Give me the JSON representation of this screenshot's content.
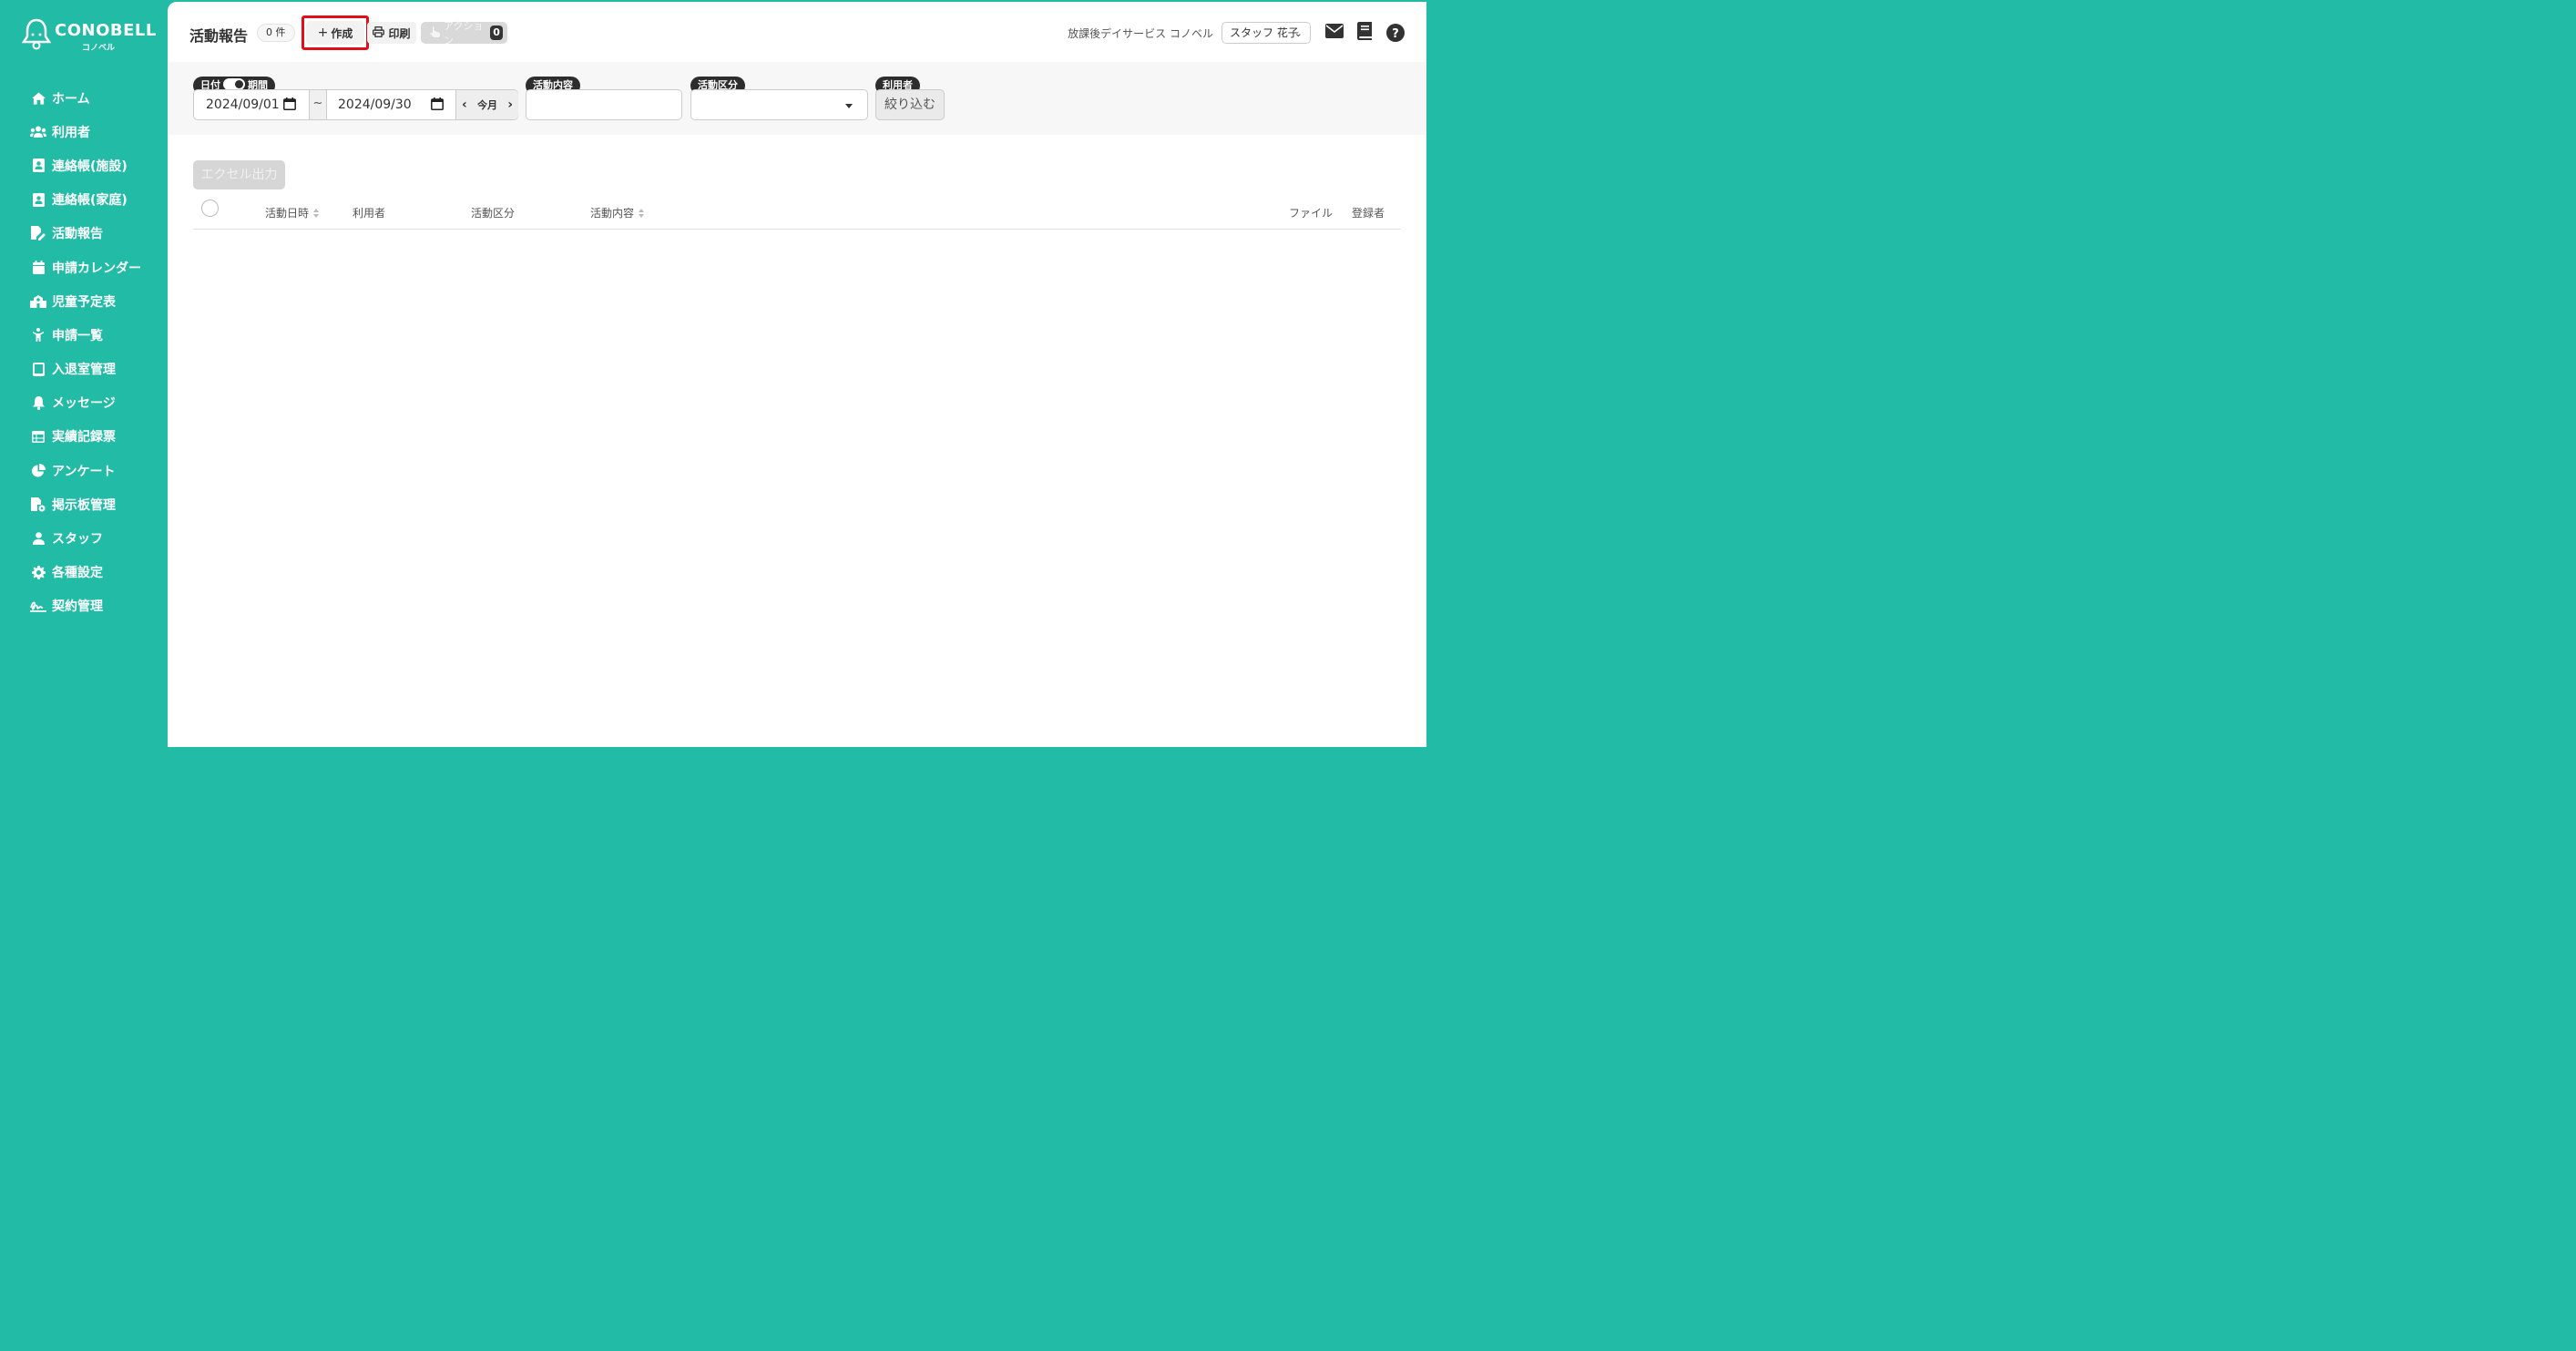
{
  "brand": {
    "name": "CONOBELL",
    "sub": "コノベル"
  },
  "sidebar": {
    "items": [
      {
        "label": "ホーム",
        "icon": "home-icon"
      },
      {
        "label": "利用者",
        "icon": "users-icon"
      },
      {
        "label": "連絡帳(施設)",
        "icon": "contact-book-icon"
      },
      {
        "label": "連絡帳(家庭)",
        "icon": "contact-book-icon"
      },
      {
        "label": "活動報告",
        "icon": "file-edit-icon"
      },
      {
        "label": "申請カレンダー",
        "icon": "calendar-icon"
      },
      {
        "label": "児童予定表",
        "icon": "school-icon"
      },
      {
        "label": "申請一覧",
        "icon": "child-icon"
      },
      {
        "label": "入退室管理",
        "icon": "tablet-icon"
      },
      {
        "label": "メッセージ",
        "icon": "bell-icon"
      },
      {
        "label": "実績記録票",
        "icon": "table-icon"
      },
      {
        "label": "アンケート",
        "icon": "pie-chart-icon"
      },
      {
        "label": "掲示板管理",
        "icon": "file-settings-icon"
      },
      {
        "label": "スタッフ",
        "icon": "user-icon"
      },
      {
        "label": "各種設定",
        "icon": "gear-icon"
      },
      {
        "label": "契約管理",
        "icon": "signature-icon"
      }
    ]
  },
  "header": {
    "title": "活動報告",
    "count": "0 件",
    "create_label": "作成",
    "print_label": "印刷",
    "action_label": "アクション",
    "action_count": "0",
    "facility": "放課後デイサービス コノベル",
    "staff": "スタッフ 花子"
  },
  "filters": {
    "date_chip_left": "日付",
    "date_chip_right": "期間",
    "date_from": "2024/09/01",
    "date_sep": "~",
    "date_to": "2024/09/30",
    "this_month": "今月",
    "content_label": "活動内容",
    "content_value": "",
    "category_label": "活動区分",
    "category_value": "",
    "user_label": "利用者",
    "filter_button": "絞り込む"
  },
  "excel_button": "エクセル出力",
  "table": {
    "columns": [
      "活動日時",
      "利用者",
      "活動区分",
      "活動内容",
      "ファイル",
      "登録者"
    ],
    "rows": []
  },
  "colors": {
    "brand": "#21bba6",
    "highlight": "#e0101a",
    "chip": "#2d2d2d"
  }
}
